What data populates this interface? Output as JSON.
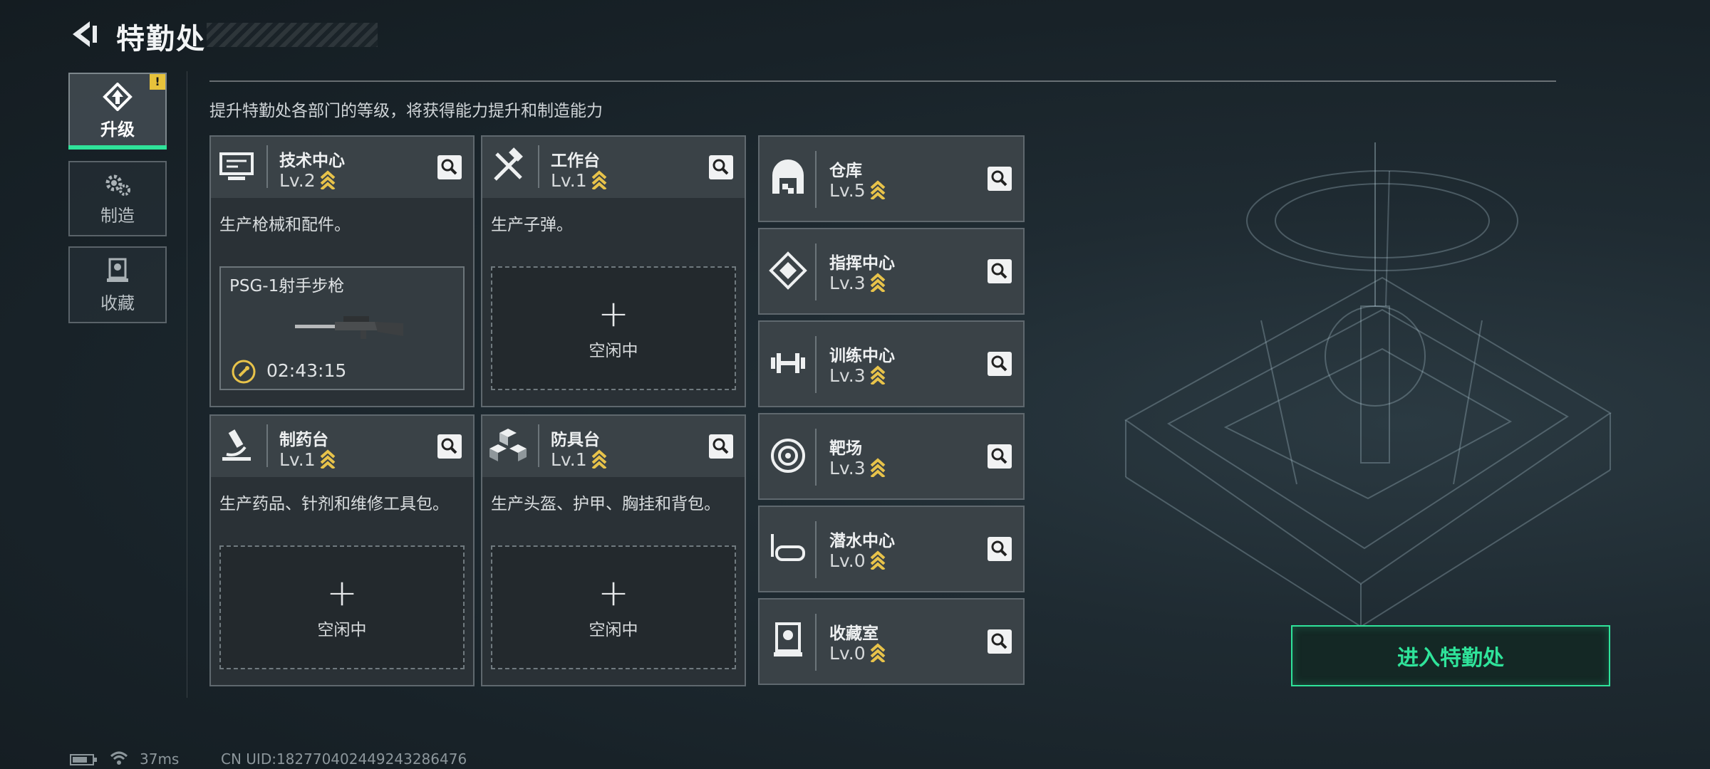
{
  "header": {
    "title": "特勤处"
  },
  "nav": [
    {
      "label": "升级",
      "icon": "upgrade-icon",
      "active": true,
      "badge": "!"
    },
    {
      "label": "制造",
      "icon": "gears-icon",
      "active": false
    },
    {
      "label": "收藏",
      "icon": "collection-icon",
      "active": false
    }
  ],
  "subtitle": "提升特勤处各部门的等级，将获得能力提升和制造能力",
  "departments": [
    {
      "name": "技术中心",
      "level": "Lv.2",
      "icon": "monitor-icon",
      "desc": "生产枪械和配件。",
      "slot": {
        "state": "crafting",
        "item": "PSG-1射手步枪",
        "timer": "02:43:15"
      }
    },
    {
      "name": "工作台",
      "level": "Lv.1",
      "icon": "tools-icon",
      "desc": "生产子弹。",
      "slot": {
        "state": "idle",
        "text": "空闲中"
      }
    },
    {
      "name": "制药台",
      "level": "Lv.1",
      "icon": "microscope-icon",
      "desc": "生产药品、针剂和维修工具包。",
      "slot": {
        "state": "idle",
        "text": "空闲中"
      }
    },
    {
      "name": "防具台",
      "level": "Lv.1",
      "icon": "armor-cubes-icon",
      "desc": "生产头盔、护甲、胸挂和背包。",
      "slot": {
        "state": "idle",
        "text": "空闲中"
      }
    }
  ],
  "facilities": [
    {
      "name": "仓库",
      "level": "Lv.5",
      "icon": "warehouse-icon"
    },
    {
      "name": "指挥中心",
      "level": "Lv.3",
      "icon": "command-icon"
    },
    {
      "name": "训练中心",
      "level": "Lv.3",
      "icon": "dumbbell-icon"
    },
    {
      "name": "靶场",
      "level": "Lv.3",
      "icon": "target-icon"
    },
    {
      "name": "潜水中心",
      "level": "Lv.0",
      "icon": "diving-mask-icon"
    },
    {
      "name": "收藏室",
      "level": "Lv.0",
      "icon": "trophy-case-icon"
    }
  ],
  "enter_button": "进入特勤处",
  "status": {
    "ping": "37ms",
    "uid": "CN UID:182770402449243286476"
  },
  "colors": {
    "accent": "#2fe39a",
    "level_chevron": "#e8c34a",
    "badge": "#e7c23b"
  }
}
